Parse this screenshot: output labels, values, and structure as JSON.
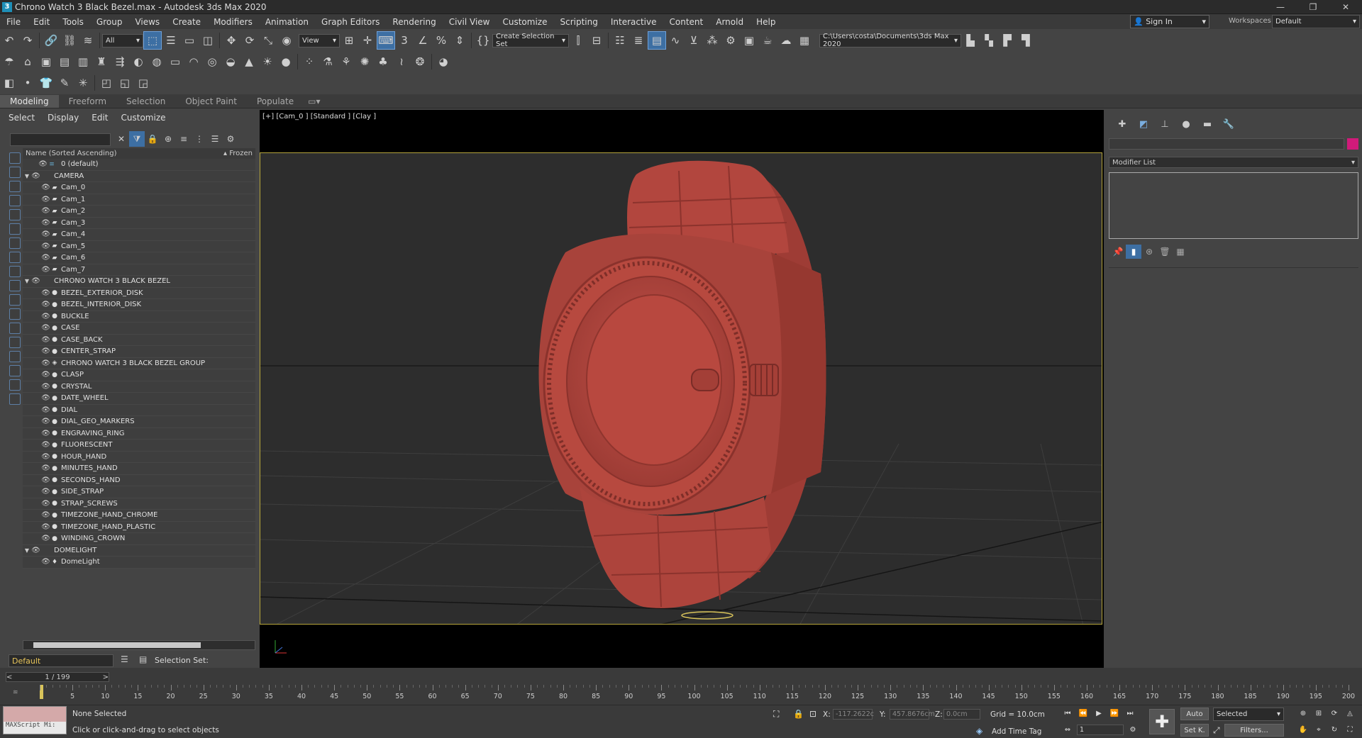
{
  "window": {
    "title": "Chrono Watch 3 Black Bezel.max - Autodesk 3ds Max 2020",
    "controls": [
      "—",
      "❐",
      "✕"
    ]
  },
  "menu": [
    "File",
    "Edit",
    "Tools",
    "Group",
    "Views",
    "Create",
    "Modifiers",
    "Animation",
    "Graph Editors",
    "Rendering",
    "Civil View",
    "Customize",
    "Scripting",
    "Interactive",
    "Content",
    "Arnold",
    "Help"
  ],
  "account": {
    "sign_in": "Sign In",
    "workspaces_label": "Workspaces:",
    "workspace": "Default"
  },
  "toolbar": {
    "filter": "All",
    "ref_coord": "View",
    "selection_set": "Create Selection Set",
    "project_path": "C:\\Users\\costa\\Documents\\3ds Max 2020"
  },
  "ribbon_tabs": [
    "Modeling",
    "Freeform",
    "Selection",
    "Object Paint",
    "Populate"
  ],
  "scene_explorer": {
    "menu": [
      "Select",
      "Display",
      "Edit",
      "Customize"
    ],
    "col_name": "Name (Sorted Ascending)",
    "col_frozen": "Frozen",
    "rows": [
      {
        "label": "0 (default)",
        "level": 0,
        "type": "layer",
        "tri": ""
      },
      {
        "label": "CAMERA",
        "level": 0,
        "type": "group",
        "tri": "▼"
      },
      {
        "label": "Cam_0",
        "level": 1,
        "type": "camera",
        "tri": ""
      },
      {
        "label": "Cam_1",
        "level": 1,
        "type": "camera",
        "tri": ""
      },
      {
        "label": "Cam_2",
        "level": 1,
        "type": "camera",
        "tri": ""
      },
      {
        "label": "Cam_3",
        "level": 1,
        "type": "camera",
        "tri": ""
      },
      {
        "label": "Cam_4",
        "level": 1,
        "type": "camera",
        "tri": ""
      },
      {
        "label": "Cam_5",
        "level": 1,
        "type": "camera",
        "tri": ""
      },
      {
        "label": "Cam_6",
        "level": 1,
        "type": "camera",
        "tri": ""
      },
      {
        "label": "Cam_7",
        "level": 1,
        "type": "camera",
        "tri": ""
      },
      {
        "label": "CHRONO WATCH 3 BLACK BEZEL",
        "level": 0,
        "type": "group",
        "tri": "▼"
      },
      {
        "label": "BEZEL_EXTERIOR_DISK",
        "level": 1,
        "type": "object",
        "tri": ""
      },
      {
        "label": "BEZEL_INTERIOR_DISK",
        "level": 1,
        "type": "object",
        "tri": ""
      },
      {
        "label": "BUCKLE",
        "level": 1,
        "type": "object",
        "tri": ""
      },
      {
        "label": "CASE",
        "level": 1,
        "type": "object",
        "tri": ""
      },
      {
        "label": "CASE_BACK",
        "level": 1,
        "type": "object",
        "tri": ""
      },
      {
        "label": "CENTER_STRAP",
        "level": 1,
        "type": "object",
        "tri": ""
      },
      {
        "label": "CHRONO WATCH 3 BLACK BEZEL GROUP",
        "level": 1,
        "type": "grp",
        "tri": ""
      },
      {
        "label": "CLASP",
        "level": 1,
        "type": "object",
        "tri": ""
      },
      {
        "label": "CRYSTAL",
        "level": 1,
        "type": "object",
        "tri": ""
      },
      {
        "label": "DATE_WHEEL",
        "level": 1,
        "type": "object",
        "tri": ""
      },
      {
        "label": "DIAL",
        "level": 1,
        "type": "object",
        "tri": ""
      },
      {
        "label": "DIAL_GEO_MARKERS",
        "level": 1,
        "type": "object",
        "tri": ""
      },
      {
        "label": "ENGRAVING_RING",
        "level": 1,
        "type": "object",
        "tri": ""
      },
      {
        "label": "FLUORESCENT",
        "level": 1,
        "type": "object",
        "tri": ""
      },
      {
        "label": "HOUR_HAND",
        "level": 1,
        "type": "object",
        "tri": ""
      },
      {
        "label": "MINUTES_HAND",
        "level": 1,
        "type": "object",
        "tri": ""
      },
      {
        "label": "SECONDS_HAND",
        "level": 1,
        "type": "object",
        "tri": ""
      },
      {
        "label": "SIDE_STRAP",
        "level": 1,
        "type": "object",
        "tri": ""
      },
      {
        "label": "STRAP_SCREWS",
        "level": 1,
        "type": "object",
        "tri": ""
      },
      {
        "label": "TIMEZONE_HAND_CHROME",
        "level": 1,
        "type": "object",
        "tri": ""
      },
      {
        "label": "TIMEZONE_HAND_PLASTIC",
        "level": 1,
        "type": "object",
        "tri": ""
      },
      {
        "label": "WINDING_CROWN",
        "level": 1,
        "type": "object",
        "tri": ""
      },
      {
        "label": "DOMELIGHT",
        "level": 0,
        "type": "group",
        "tri": "▼"
      },
      {
        "label": "DomeLight",
        "level": 1,
        "type": "light",
        "tri": ""
      }
    ],
    "layer": "Default",
    "selection_set_label": "Selection Set:"
  },
  "viewport": {
    "label": "[+] [Cam_0 ] [Standard ] [Clay ]",
    "model_color": "#b3483f",
    "safe_frame_color": "#b5a43b"
  },
  "command_panel": {
    "modifier_list": "Modifier List",
    "object_color": "#d11a7a"
  },
  "timeline": {
    "frame": "1 / 199",
    "ticks": [
      5,
      10,
      15,
      20,
      25,
      30,
      35,
      40,
      45,
      50,
      55,
      60,
      65,
      70,
      75,
      80,
      85,
      90,
      95,
      100,
      105,
      110,
      115,
      120,
      125,
      130,
      135,
      140,
      145,
      150,
      155,
      160,
      165,
      170,
      175,
      180,
      185,
      190,
      195,
      200
    ]
  },
  "status": {
    "maxscript": "MAXScript Mi:",
    "selection": "None Selected",
    "prompt": "Click or click-and-drag to select objects",
    "x_label": "X:",
    "x_value": "-117.2622c",
    "y_label": "Y:",
    "y_value": "457.8676cm",
    "z_label": "Z:",
    "z_value": "0.0cm",
    "grid": "Grid = 10.0cm",
    "add_time_tag": "Add Time Tag",
    "auto_key": "Auto",
    "selected": "Selected",
    "set_key": "Set K.",
    "filters": "Filters...",
    "frame_field": "1"
  }
}
